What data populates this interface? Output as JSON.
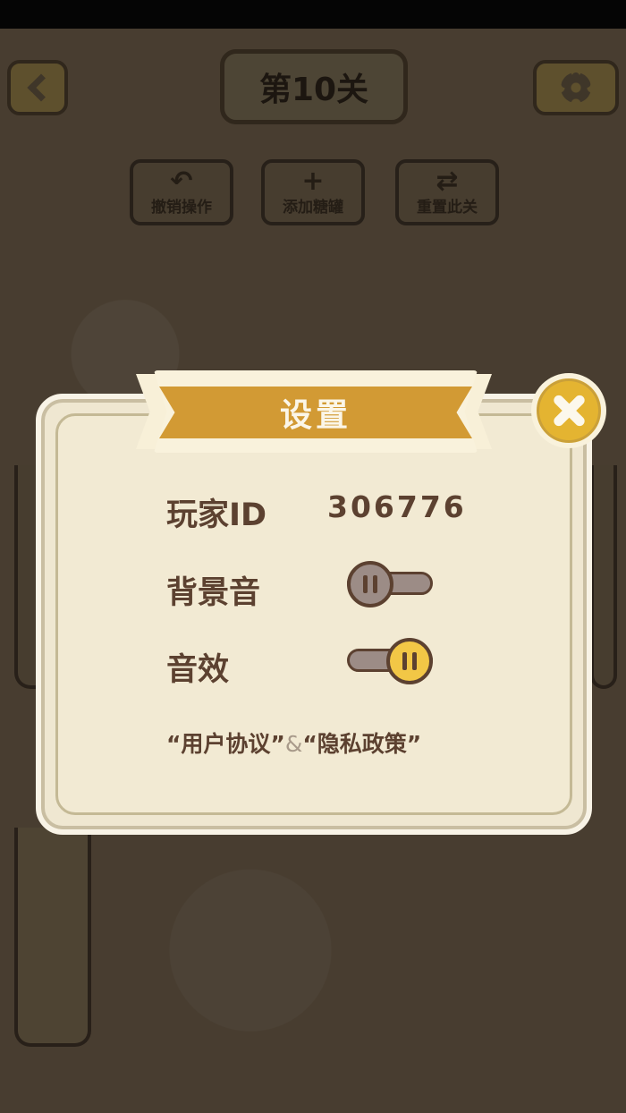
{
  "topbar": {
    "level_title": "第10关",
    "back_icon": "chevron-left-icon",
    "settings_icon": "gear-icon"
  },
  "tools": [
    {
      "label": "撤销操作",
      "icon": "undo-icon",
      "glyph": "↶"
    },
    {
      "label": "添加糖罐",
      "icon": "plus-icon",
      "glyph": "+"
    },
    {
      "label": "重置此关",
      "icon": "refresh-icon",
      "glyph": "⇄"
    }
  ],
  "dialog": {
    "title": "设置",
    "close_icon": "close-icon",
    "player_id_label": "玩家ID",
    "player_id_value": "306776",
    "bgm_label": "背景音",
    "bgm_on": false,
    "sfx_label": "音效",
    "sfx_on": true,
    "user_agreement_link": "“用户协议”",
    "ampersand": "&",
    "privacy_policy_link": "“隐私政策”"
  },
  "colors": {
    "ribbon": "#d29a34",
    "close_button": "#e4b431",
    "toggle_on_knob": "#f2c746",
    "text_brown": "#5c4130"
  }
}
